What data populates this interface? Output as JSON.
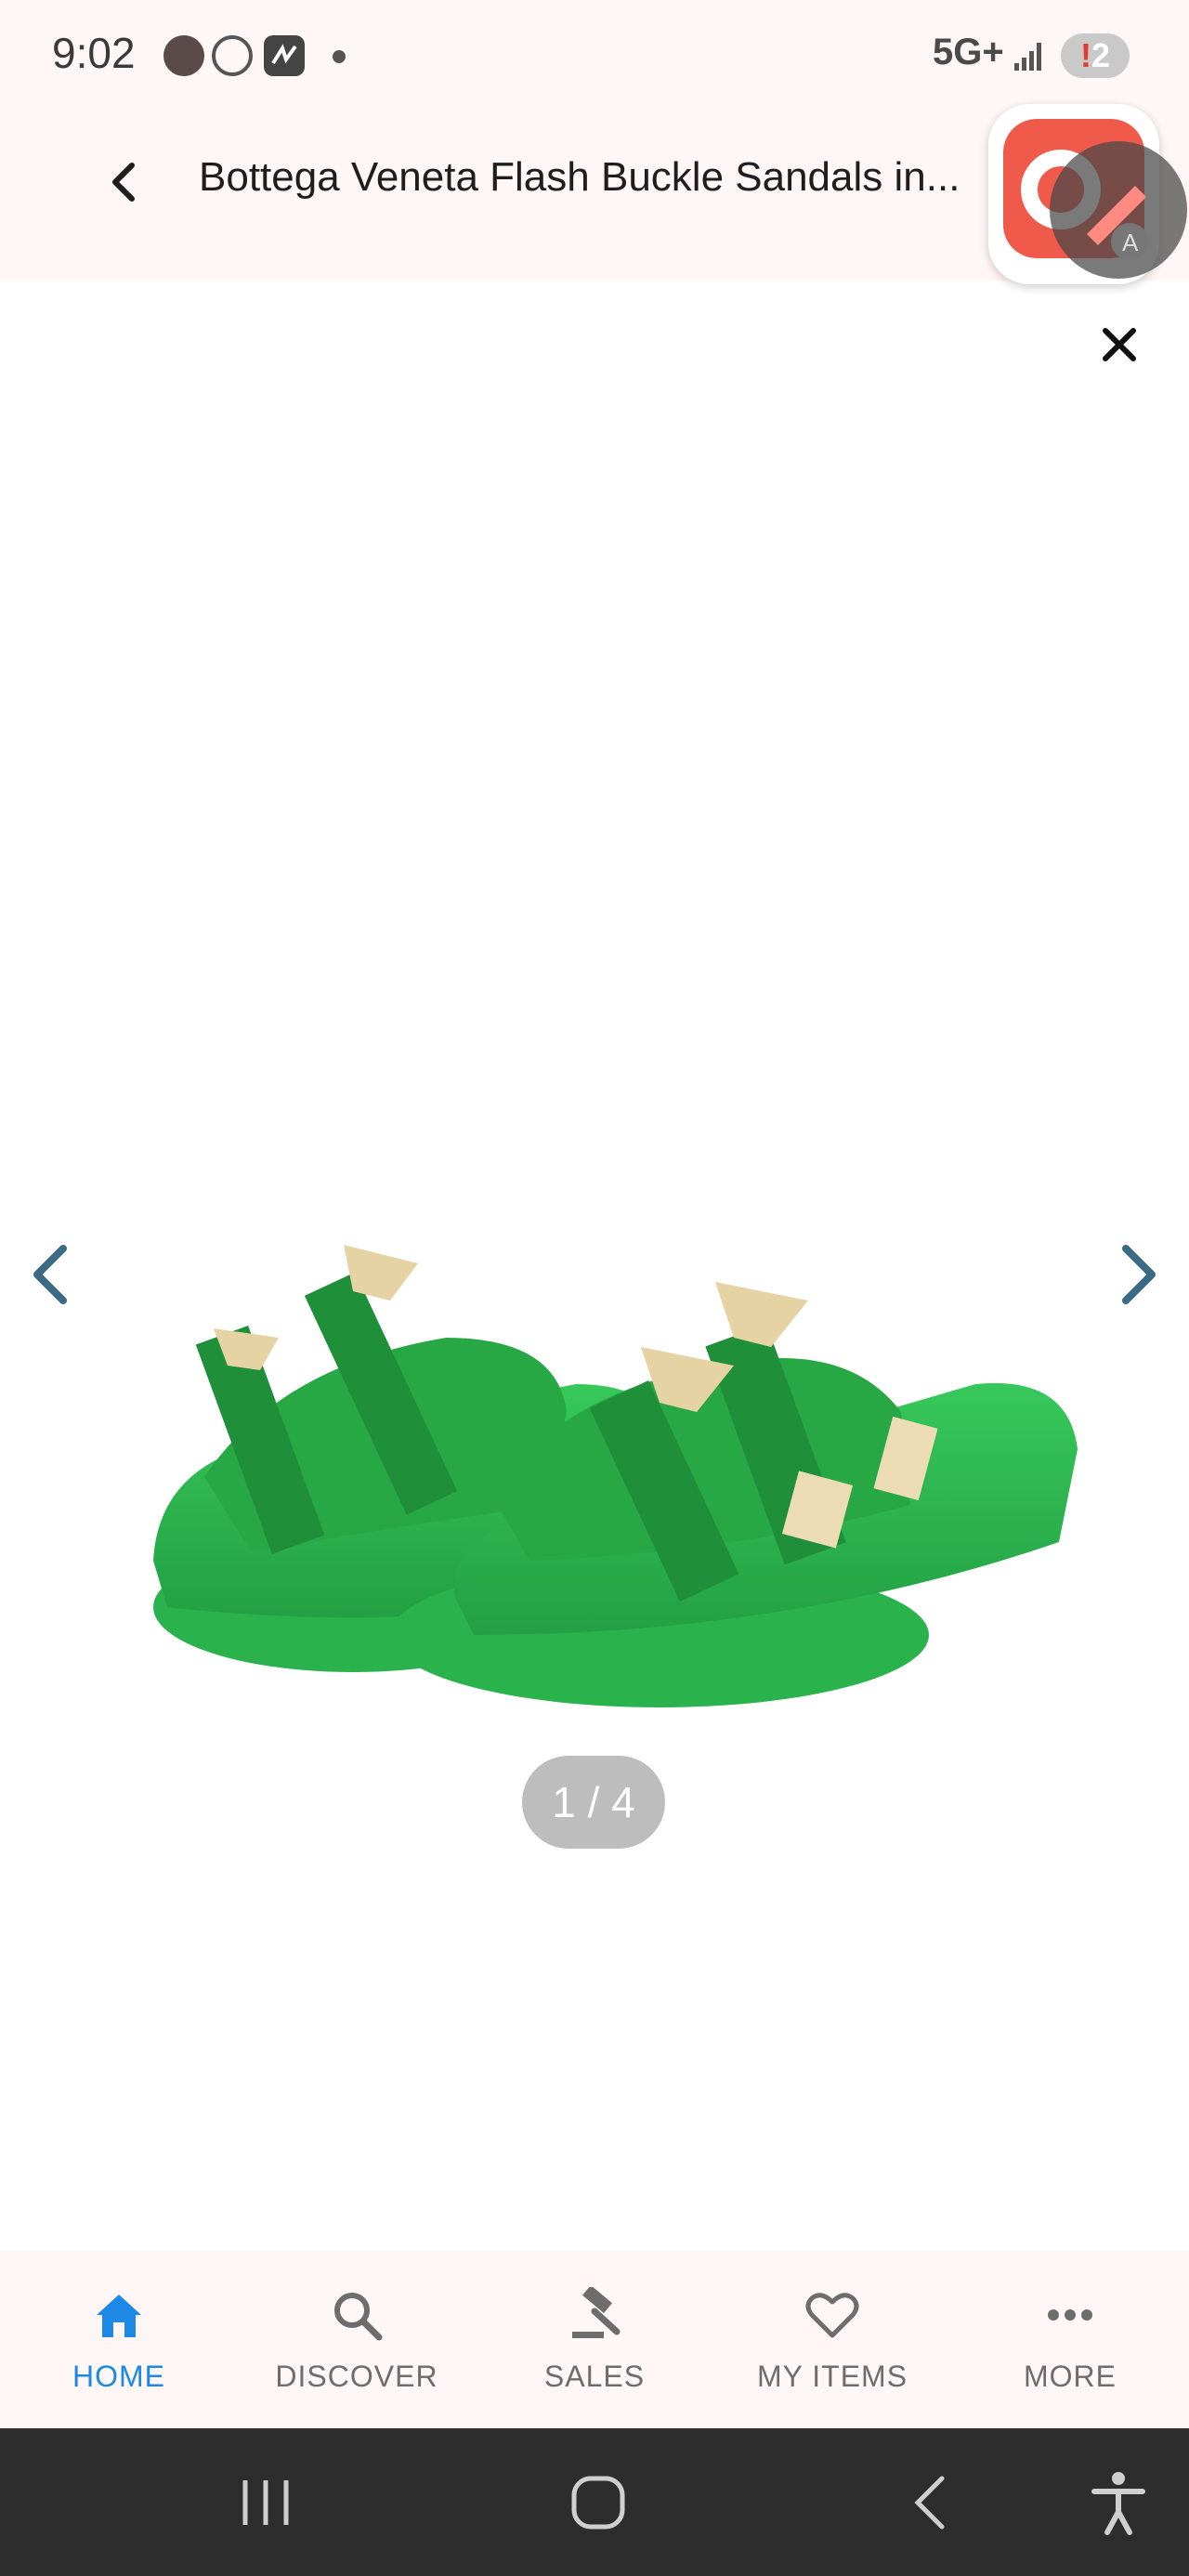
{
  "status_bar": {
    "time": "9:02",
    "network": "5G+",
    "notification_count": "2",
    "notification_mark": "!"
  },
  "header": {
    "title": "Bottega Veneta Flash Buckle Sandals in...",
    "back_icon": "chevron-left-icon"
  },
  "viewer": {
    "close_icon": "close-icon",
    "image_description_icon": "product-photo",
    "page_counter": "1 / 4",
    "prev_icon": "chevron-left-icon",
    "next_icon": "chevron-right-icon"
  },
  "bottom_nav": {
    "items": [
      {
        "label": "HOME",
        "icon": "home-icon",
        "active": true
      },
      {
        "label": "DISCOVER",
        "icon": "search-icon",
        "active": false
      },
      {
        "label": "SALES",
        "icon": "gavel-icon",
        "active": false
      },
      {
        "label": "MY ITEMS",
        "icon": "heart-icon",
        "active": false
      },
      {
        "label": "MORE",
        "icon": "more-horizontal-icon",
        "active": false
      }
    ]
  },
  "colors": {
    "accent": "#1e88e5",
    "chrome_background": "#fff7f5",
    "product_green": "#2fb64e",
    "arrow_color": "#3b6b82"
  }
}
